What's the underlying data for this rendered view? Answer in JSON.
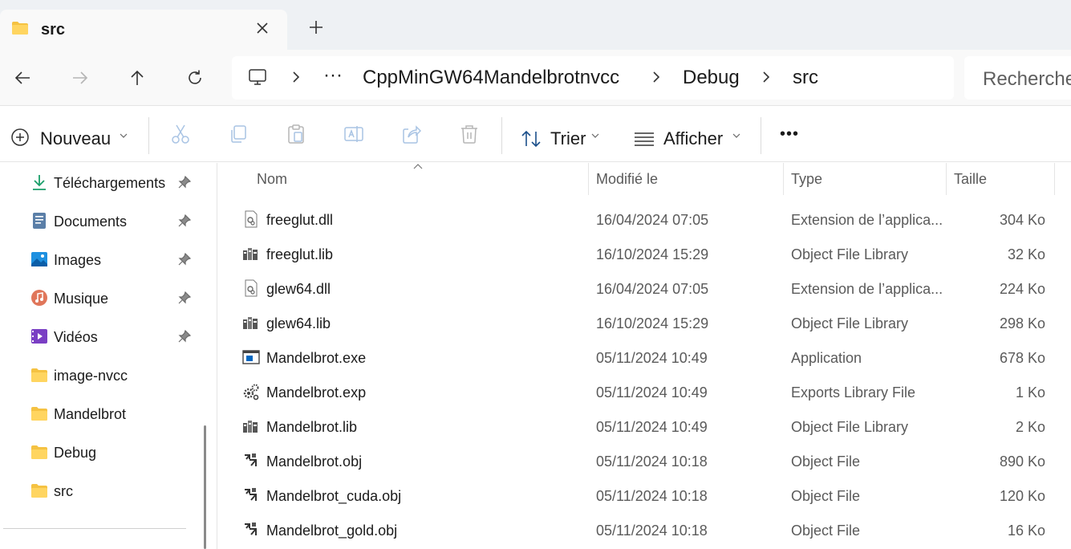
{
  "tab": {
    "title": "src",
    "close_icon": "close-icon",
    "new_tab_icon": "plus-icon"
  },
  "nav": {
    "back_icon": "arrow-left-icon",
    "forward_icon": "arrow-right-icon",
    "up_icon": "arrow-up-icon",
    "refresh_icon": "refresh-icon"
  },
  "address": {
    "root_icon": "monitor-icon",
    "overflow": "···",
    "crumbs": [
      "CppMinGW64Mandelbrotnvcc",
      "Debug",
      "src"
    ]
  },
  "search": {
    "placeholder": "Recherche"
  },
  "commandbar": {
    "new_label": "Nouveau",
    "sort_label": "Trier",
    "view_label": "Afficher",
    "more_label": "•••"
  },
  "sidebar": {
    "items": [
      {
        "label": "Téléchargements",
        "icon": "download-icon",
        "pinned": true
      },
      {
        "label": "Documents",
        "icon": "documents-icon",
        "pinned": true
      },
      {
        "label": "Images",
        "icon": "images-icon",
        "pinned": true
      },
      {
        "label": "Musique",
        "icon": "music-icon",
        "pinned": true
      },
      {
        "label": "Vidéos",
        "icon": "videos-icon",
        "pinned": true
      },
      {
        "label": "image-nvcc",
        "icon": "folder-icon",
        "pinned": false
      },
      {
        "label": "Mandelbrot",
        "icon": "folder-icon",
        "pinned": false
      },
      {
        "label": "Debug",
        "icon": "folder-icon",
        "pinned": false
      },
      {
        "label": "src",
        "icon": "folder-icon",
        "pinned": false
      }
    ]
  },
  "columns": {
    "name": "Nom",
    "modified": "Modifié le",
    "type": "Type",
    "size": "Taille"
  },
  "files": [
    {
      "name": "freeglut.dll",
      "modified": "16/04/2024 07:05",
      "type": "Extension de l’applica...",
      "size": "304 Ko",
      "icon": "dll-icon"
    },
    {
      "name": "freeglut.lib",
      "modified": "16/10/2024 15:29",
      "type": "Object File Library",
      "size": "32 Ko",
      "icon": "library-icon"
    },
    {
      "name": "glew64.dll",
      "modified": "16/04/2024 07:05",
      "type": "Extension de l’applica...",
      "size": "224 Ko",
      "icon": "dll-icon"
    },
    {
      "name": "glew64.lib",
      "modified": "16/10/2024 15:29",
      "type": "Object File Library",
      "size": "298 Ko",
      "icon": "library-icon"
    },
    {
      "name": "Mandelbrot.exe",
      "modified": "05/11/2024 10:49",
      "type": "Application",
      "size": "678 Ko",
      "icon": "exe-icon"
    },
    {
      "name": "Mandelbrot.exp",
      "modified": "05/11/2024 10:49",
      "type": "Exports Library File",
      "size": "1 Ko",
      "icon": "gears-icon"
    },
    {
      "name": "Mandelbrot.lib",
      "modified": "05/11/2024 10:49",
      "type": "Object File Library",
      "size": "2 Ko",
      "icon": "library-icon"
    },
    {
      "name": "Mandelbrot.obj",
      "modified": "05/11/2024 10:18",
      "type": "Object File",
      "size": "890 Ko",
      "icon": "object-icon"
    },
    {
      "name": "Mandelbrot_cuda.obj",
      "modified": "05/11/2024 10:18",
      "type": "Object File",
      "size": "120 Ko",
      "icon": "object-icon"
    },
    {
      "name": "Mandelbrot_gold.obj",
      "modified": "05/11/2024 10:18",
      "type": "Object File",
      "size": "16 Ko",
      "icon": "object-icon"
    }
  ],
  "colors": {
    "folder": "#f5c242",
    "accent": "#0067c0",
    "download": "#1a9e6a"
  }
}
